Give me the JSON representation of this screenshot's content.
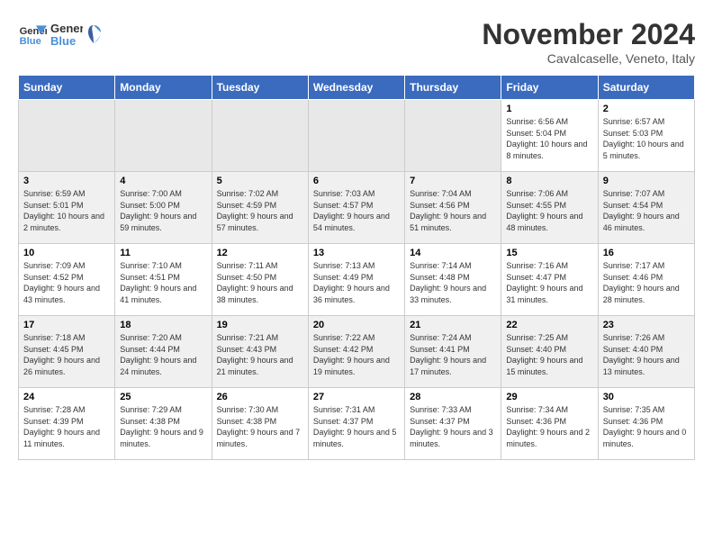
{
  "header": {
    "logo_line1": "General",
    "logo_line2": "Blue",
    "month_title": "November 2024",
    "location": "Cavalcaselle, Veneto, Italy"
  },
  "days_of_week": [
    "Sunday",
    "Monday",
    "Tuesday",
    "Wednesday",
    "Thursday",
    "Friday",
    "Saturday"
  ],
  "weeks": [
    {
      "row_class": "row-even",
      "days": [
        {
          "date": "",
          "empty": true
        },
        {
          "date": "",
          "empty": true
        },
        {
          "date": "",
          "empty": true
        },
        {
          "date": "",
          "empty": true
        },
        {
          "date": "",
          "empty": true
        },
        {
          "date": "1",
          "sunrise": "Sunrise: 6:56 AM",
          "sunset": "Sunset: 5:04 PM",
          "daylight": "Daylight: 10 hours and 8 minutes."
        },
        {
          "date": "2",
          "sunrise": "Sunrise: 6:57 AM",
          "sunset": "Sunset: 5:03 PM",
          "daylight": "Daylight: 10 hours and 5 minutes."
        }
      ]
    },
    {
      "row_class": "row-odd",
      "days": [
        {
          "date": "3",
          "sunrise": "Sunrise: 6:59 AM",
          "sunset": "Sunset: 5:01 PM",
          "daylight": "Daylight: 10 hours and 2 minutes."
        },
        {
          "date": "4",
          "sunrise": "Sunrise: 7:00 AM",
          "sunset": "Sunset: 5:00 PM",
          "daylight": "Daylight: 9 hours and 59 minutes."
        },
        {
          "date": "5",
          "sunrise": "Sunrise: 7:02 AM",
          "sunset": "Sunset: 4:59 PM",
          "daylight": "Daylight: 9 hours and 57 minutes."
        },
        {
          "date": "6",
          "sunrise": "Sunrise: 7:03 AM",
          "sunset": "Sunset: 4:57 PM",
          "daylight": "Daylight: 9 hours and 54 minutes."
        },
        {
          "date": "7",
          "sunrise": "Sunrise: 7:04 AM",
          "sunset": "Sunset: 4:56 PM",
          "daylight": "Daylight: 9 hours and 51 minutes."
        },
        {
          "date": "8",
          "sunrise": "Sunrise: 7:06 AM",
          "sunset": "Sunset: 4:55 PM",
          "daylight": "Daylight: 9 hours and 48 minutes."
        },
        {
          "date": "9",
          "sunrise": "Sunrise: 7:07 AM",
          "sunset": "Sunset: 4:54 PM",
          "daylight": "Daylight: 9 hours and 46 minutes."
        }
      ]
    },
    {
      "row_class": "row-even",
      "days": [
        {
          "date": "10",
          "sunrise": "Sunrise: 7:09 AM",
          "sunset": "Sunset: 4:52 PM",
          "daylight": "Daylight: 9 hours and 43 minutes."
        },
        {
          "date": "11",
          "sunrise": "Sunrise: 7:10 AM",
          "sunset": "Sunset: 4:51 PM",
          "daylight": "Daylight: 9 hours and 41 minutes."
        },
        {
          "date": "12",
          "sunrise": "Sunrise: 7:11 AM",
          "sunset": "Sunset: 4:50 PM",
          "daylight": "Daylight: 9 hours and 38 minutes."
        },
        {
          "date": "13",
          "sunrise": "Sunrise: 7:13 AM",
          "sunset": "Sunset: 4:49 PM",
          "daylight": "Daylight: 9 hours and 36 minutes."
        },
        {
          "date": "14",
          "sunrise": "Sunrise: 7:14 AM",
          "sunset": "Sunset: 4:48 PM",
          "daylight": "Daylight: 9 hours and 33 minutes."
        },
        {
          "date": "15",
          "sunrise": "Sunrise: 7:16 AM",
          "sunset": "Sunset: 4:47 PM",
          "daylight": "Daylight: 9 hours and 31 minutes."
        },
        {
          "date": "16",
          "sunrise": "Sunrise: 7:17 AM",
          "sunset": "Sunset: 4:46 PM",
          "daylight": "Daylight: 9 hours and 28 minutes."
        }
      ]
    },
    {
      "row_class": "row-odd",
      "days": [
        {
          "date": "17",
          "sunrise": "Sunrise: 7:18 AM",
          "sunset": "Sunset: 4:45 PM",
          "daylight": "Daylight: 9 hours and 26 minutes."
        },
        {
          "date": "18",
          "sunrise": "Sunrise: 7:20 AM",
          "sunset": "Sunset: 4:44 PM",
          "daylight": "Daylight: 9 hours and 24 minutes."
        },
        {
          "date": "19",
          "sunrise": "Sunrise: 7:21 AM",
          "sunset": "Sunset: 4:43 PM",
          "daylight": "Daylight: 9 hours and 21 minutes."
        },
        {
          "date": "20",
          "sunrise": "Sunrise: 7:22 AM",
          "sunset": "Sunset: 4:42 PM",
          "daylight": "Daylight: 9 hours and 19 minutes."
        },
        {
          "date": "21",
          "sunrise": "Sunrise: 7:24 AM",
          "sunset": "Sunset: 4:41 PM",
          "daylight": "Daylight: 9 hours and 17 minutes."
        },
        {
          "date": "22",
          "sunrise": "Sunrise: 7:25 AM",
          "sunset": "Sunset: 4:40 PM",
          "daylight": "Daylight: 9 hours and 15 minutes."
        },
        {
          "date": "23",
          "sunrise": "Sunrise: 7:26 AM",
          "sunset": "Sunset: 4:40 PM",
          "daylight": "Daylight: 9 hours and 13 minutes."
        }
      ]
    },
    {
      "row_class": "row-even",
      "days": [
        {
          "date": "24",
          "sunrise": "Sunrise: 7:28 AM",
          "sunset": "Sunset: 4:39 PM",
          "daylight": "Daylight: 9 hours and 11 minutes."
        },
        {
          "date": "25",
          "sunrise": "Sunrise: 7:29 AM",
          "sunset": "Sunset: 4:38 PM",
          "daylight": "Daylight: 9 hours and 9 minutes."
        },
        {
          "date": "26",
          "sunrise": "Sunrise: 7:30 AM",
          "sunset": "Sunset: 4:38 PM",
          "daylight": "Daylight: 9 hours and 7 minutes."
        },
        {
          "date": "27",
          "sunrise": "Sunrise: 7:31 AM",
          "sunset": "Sunset: 4:37 PM",
          "daylight": "Daylight: 9 hours and 5 minutes."
        },
        {
          "date": "28",
          "sunrise": "Sunrise: 7:33 AM",
          "sunset": "Sunset: 4:37 PM",
          "daylight": "Daylight: 9 hours and 3 minutes."
        },
        {
          "date": "29",
          "sunrise": "Sunrise: 7:34 AM",
          "sunset": "Sunset: 4:36 PM",
          "daylight": "Daylight: 9 hours and 2 minutes."
        },
        {
          "date": "30",
          "sunrise": "Sunrise: 7:35 AM",
          "sunset": "Sunset: 4:36 PM",
          "daylight": "Daylight: 9 hours and 0 minutes."
        }
      ]
    }
  ]
}
